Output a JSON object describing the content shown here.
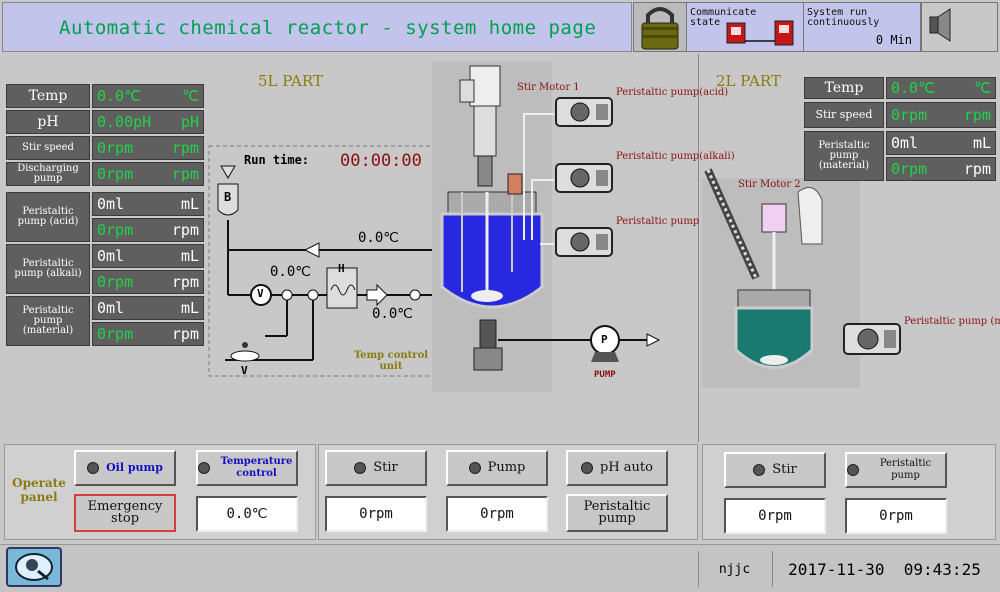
{
  "header": {
    "title": "Automatic chemical reactor - system home page",
    "communicate_state_label": "Communicate state",
    "system_run_label": "System run continuously",
    "system_run_value": "0 Min"
  },
  "left": {
    "part_title": "5L PART",
    "run_time_label": "Run time:",
    "run_time_value": "00:00:00",
    "rows": [
      {
        "label": "Temp",
        "value": "0.0℃",
        "unit": "℃"
      },
      {
        "label": "pH",
        "value": "0.00pH",
        "unit": "pH"
      },
      {
        "label": "Stir speed",
        "value": "0rpm",
        "unit": "rpm"
      },
      {
        "label": "Discharging pump",
        "value": "0rpm",
        "unit": "rpm"
      },
      {
        "label": "Peristaltic pump (acid)",
        "value": "0ml",
        "unit": "mL",
        "value2": "0rpm",
        "unit2": "rpm"
      },
      {
        "label": "Peristaltic pump (alkali)",
        "value": "0ml",
        "unit": "mL",
        "value2": "0rpm",
        "unit2": "rpm"
      },
      {
        "label": "Peristaltic pump (material)",
        "value": "0ml",
        "unit": "mL",
        "value2": "0rpm",
        "unit2": "rpm"
      }
    ]
  },
  "diagram": {
    "temp_b": "0.0℃",
    "temp_v": "0.0℃",
    "temp_h": "0.0℃",
    "temp_control_unit": "Temp control unit",
    "label_b": "B",
    "label_v": "V",
    "label_h": "H",
    "label_v2": "V",
    "label_p": "P",
    "pump_label": "PUMP",
    "stir_motor_1": "Stir Motor 1",
    "stir_motor_2": "Stir Motor 2",
    "pp_acid": "Peristaltic pump(acid)",
    "pp_alkali": "Peristaltic pump(alkali)",
    "pp_material": "Peristaltic pump (material)",
    "pp_material_2": "Peristaltic pump (material)"
  },
  "right": {
    "part_title": "2L PART",
    "rows": [
      {
        "label": "Temp",
        "value": "0.0℃",
        "unit": "℃"
      },
      {
        "label": "Stir speed",
        "value": "0rpm",
        "unit": "rpm"
      },
      {
        "label": "Peristaltic pump (material)",
        "value": "0ml",
        "unit": "mL",
        "value2": "0rpm",
        "unit2": "rpm"
      }
    ]
  },
  "operate": {
    "panel_label": "Operate panel",
    "oil_pump": "Oil pump",
    "temperature_control": "Temperature control",
    "emergency_stop": "Emergency stop",
    "temp_display": "0.0℃",
    "stir": "Stir",
    "pump": "Pump",
    "ph_auto": "pH auto",
    "stir_display": "0rpm",
    "pump_display": "0rpm",
    "peristaltic_pump": "Peristaltic pump"
  },
  "operate2": {
    "stir": "Stir",
    "peristaltic_pump": "Peristaltic pump",
    "stir_display": "0rpm",
    "pp_display": "0rpm"
  },
  "footer": {
    "user": "njjc",
    "datetime": "2017-11-30  09:43:25"
  }
}
